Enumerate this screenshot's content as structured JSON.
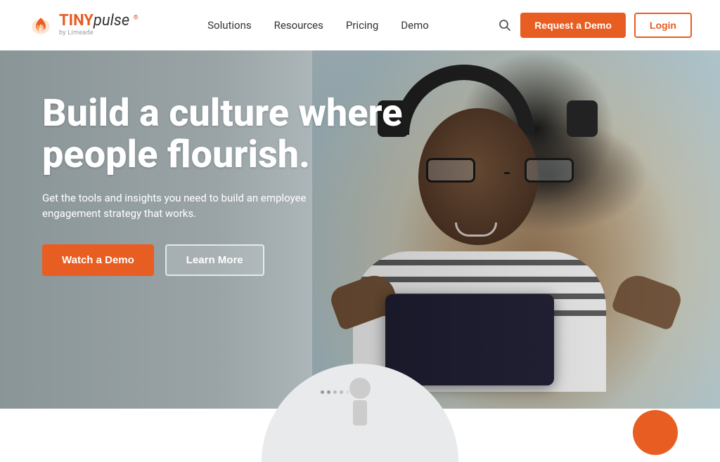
{
  "logo": {
    "brand_tiny": "TINY",
    "brand_pulse": "pulse",
    "sub": "by Limeade"
  },
  "nav": {
    "links": [
      {
        "label": "Solutions",
        "id": "solutions"
      },
      {
        "label": "Resources",
        "id": "resources"
      },
      {
        "label": "Pricing",
        "id": "pricing"
      },
      {
        "label": "Demo",
        "id": "demo"
      }
    ],
    "request_demo": "Request a Demo",
    "login": "Login"
  },
  "hero": {
    "title": "Build a culture where people flourish.",
    "subtitle": "Get the tools and insights you need to build an employee engagement strategy that works.",
    "cta_primary": "Watch a Demo",
    "cta_secondary": "Learn More"
  },
  "colors": {
    "orange": "#e85d21"
  }
}
